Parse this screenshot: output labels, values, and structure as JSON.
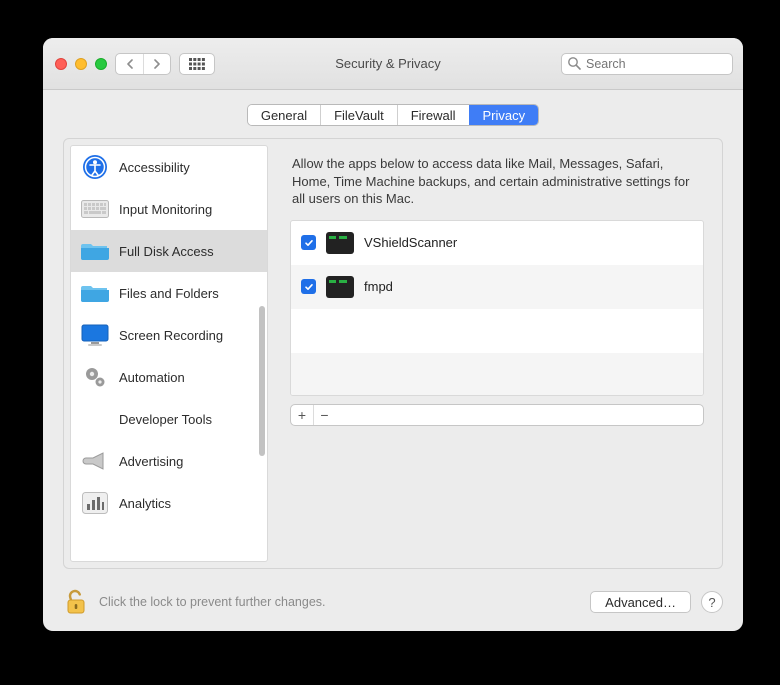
{
  "window": {
    "title": "Security & Privacy"
  },
  "search": {
    "placeholder": "Search"
  },
  "tabs": [
    {
      "label": "General",
      "active": false
    },
    {
      "label": "FileVault",
      "active": false
    },
    {
      "label": "Firewall",
      "active": false
    },
    {
      "label": "Privacy",
      "active": true
    }
  ],
  "sidebar": {
    "items": [
      {
        "label": "Accessibility",
        "icon": "accessibility",
        "selected": false
      },
      {
        "label": "Input Monitoring",
        "icon": "keyboard",
        "selected": false
      },
      {
        "label": "Full Disk Access",
        "icon": "folder-blue",
        "selected": true
      },
      {
        "label": "Files and Folders",
        "icon": "folder-blue",
        "selected": false
      },
      {
        "label": "Screen Recording",
        "icon": "display",
        "selected": false
      },
      {
        "label": "Automation",
        "icon": "gears",
        "selected": false
      },
      {
        "label": "Developer Tools",
        "icon": "none",
        "selected": false
      },
      {
        "label": "Advertising",
        "icon": "megaphone",
        "selected": false
      },
      {
        "label": "Analytics",
        "icon": "barchart",
        "selected": false
      }
    ]
  },
  "content": {
    "description": "Allow the apps below to access data like Mail, Messages, Safari, Home, Time Machine backups, and certain administrative settings for all users on this Mac.",
    "apps": [
      {
        "name": "VShieldScanner",
        "checked": true
      },
      {
        "name": "fmpd",
        "checked": true
      }
    ]
  },
  "footer": {
    "lock_note": "Click the lock to prevent further changes.",
    "advanced_label": "Advanced…"
  }
}
